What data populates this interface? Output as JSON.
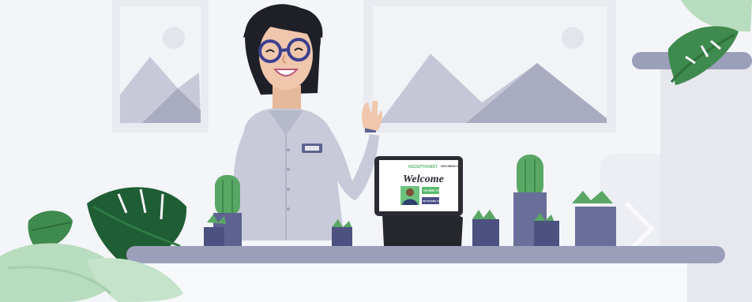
{
  "tablet": {
    "brand": "RECEPTIONIST",
    "nav_item_1": "SIGN IN",
    "nav_item_2": "SIGN OUT",
    "welcome": "Welcome",
    "btn_primary": "I'M HERE TO",
    "btn_secondary": "I'M PICKING UP"
  },
  "colors": {
    "wall": "#f4f5f8",
    "frame": "#ebedf2",
    "mountain": "#c4c6d6",
    "mountain_dark": "#a8aac0",
    "counter": "#9c9fba",
    "pot": "#5d6290",
    "pot_dark": "#4c5180",
    "leaf_dark": "#3f8a4e",
    "leaf_light": "#b7dcbe",
    "cactus": "#5aa765",
    "shirt": "#c9cad9",
    "hair": "#1f1f27",
    "skin": "#f0c7ac",
    "glasses": "#3c3f8e",
    "tablet_body": "#2b2b33",
    "tablet_button_green": "#59b96d",
    "tablet_button_navy": "#4b4f88"
  },
  "icons": [
    "receptionist-illustration",
    "tablet-kiosk",
    "plant-icon",
    "cactus-icon",
    "monstera-leaf-icon"
  ]
}
